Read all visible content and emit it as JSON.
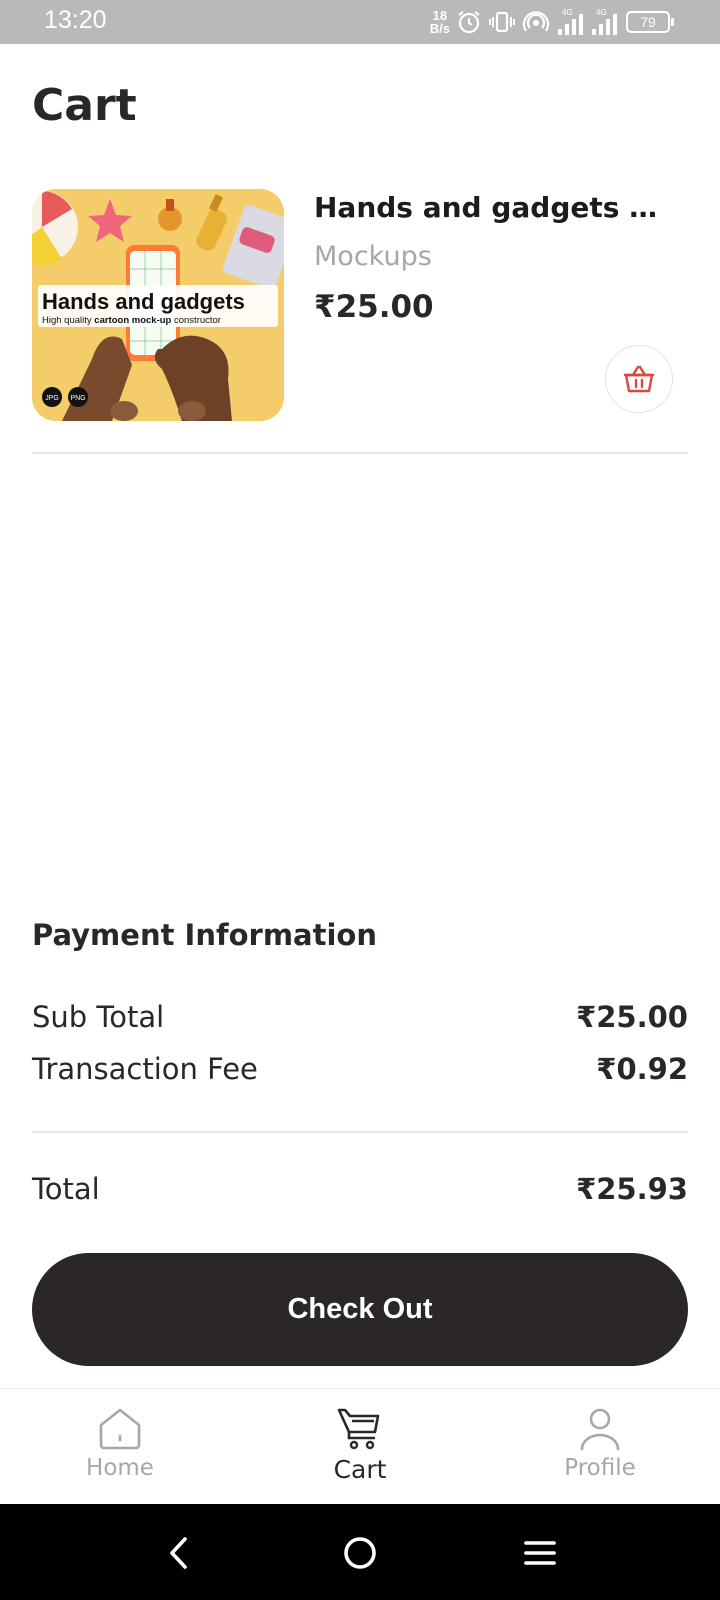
{
  "status_bar": {
    "time": "13:20",
    "net_speed_value": "18",
    "net_speed_unit": "B/s",
    "battery": "79",
    "icons": [
      "alarm-icon",
      "vibrate-icon",
      "hotspot-icon",
      "signal-4g-icon",
      "signal-4g-icon",
      "battery-icon"
    ]
  },
  "header": {
    "title": "Cart"
  },
  "cart": {
    "items": [
      {
        "name": "Hands and gadgets m...",
        "category": "Mockups",
        "price": "₹25.00",
        "thumb_title": "Hands and gadgets",
        "thumb_subtitle_pre": "High quality ",
        "thumb_subtitle_bold": "cartoon mock-up",
        "thumb_subtitle_post": " constructor",
        "thumb_badges": [
          "JPG",
          "PNG"
        ]
      }
    ]
  },
  "payment": {
    "title": "Payment Information",
    "subtotal_label": "Sub Total",
    "subtotal_value": "₹25.00",
    "fee_label": "Transaction Fee",
    "fee_value": "₹0.92",
    "total_label": "Total",
    "total_value": "₹25.93"
  },
  "checkout": {
    "label": "Check Out"
  },
  "bottom_nav": {
    "items": [
      {
        "label": "Home",
        "icon": "home-icon",
        "active": false
      },
      {
        "label": "Cart",
        "icon": "cart-icon",
        "active": true
      },
      {
        "label": "Profile",
        "icon": "profile-icon",
        "active": false
      }
    ]
  },
  "colors": {
    "primary": "#2b2727",
    "muted": "#a7a7a7",
    "danger": "#e0463c",
    "status_bar": "#b9b9b9"
  }
}
